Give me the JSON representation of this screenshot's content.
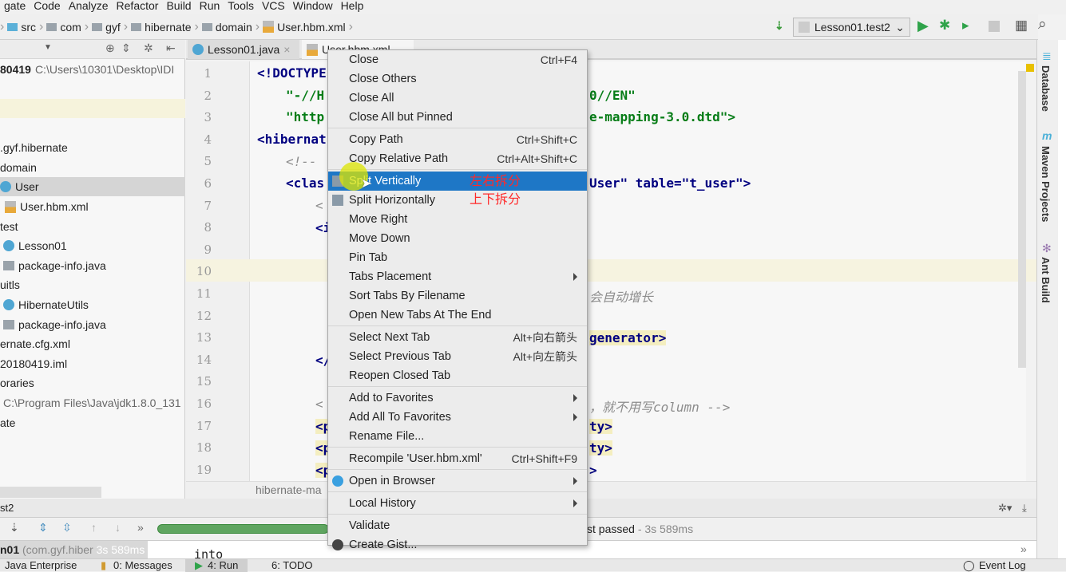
{
  "menubar": [
    "gate",
    "Code",
    "Analyze",
    "Refactor",
    "Build",
    "Run",
    "Tools",
    "VCS",
    "Window",
    "Help"
  ],
  "breadcrumb": [
    "src",
    "com",
    "gyf",
    "hibernate",
    "domain",
    "User.hbm.xml"
  ],
  "run_config": "Lesson01.test2",
  "project": {
    "root": "80419",
    "root_path": "C:\\Users\\10301\\Desktop\\IDI",
    "items": [
      ".gyf.hibernate",
      "domain",
      "User",
      "User.hbm.xml",
      "test",
      "Lesson01",
      "package-info.java",
      "uitls",
      "HibernateUtils",
      "package-info.java",
      "ernate.cfg.xml",
      "20180419.iml",
      "oraries",
      "C:\\Program Files\\Java\\jdk1.8.0_131",
      "ate"
    ]
  },
  "tabs": [
    "Lesson01.java",
    "User.hbm.xml"
  ],
  "editor": {
    "line_numbers": [
      "1",
      "2",
      "3",
      "4",
      "5",
      "6",
      "7",
      "8",
      "9",
      "10",
      "11",
      "12",
      "13",
      "14",
      "15",
      "16",
      "17",
      "18",
      "19"
    ],
    "code": {
      "l1": "<!DOCTYPE",
      "l2a": "\"-//H",
      "l2b": "0//EN\"",
      "l3a": "\"http",
      "l3b": "e-mapping-3.0.dtd\">",
      "l4": "<hibernat",
      "l5": "<!--",
      "l6a": "<clas",
      "l6b": "User\" table=\"t_user\">",
      "l7": "<",
      "l8": "<i",
      "l11": "会自动增长",
      "l13": "generator>",
      "l14": "</",
      "l16a": "<",
      "l16b": "，就不用写column -->",
      "l17a": "<p",
      "l17b": "ty>",
      "l18a": "<p",
      "l18b": "ty>",
      "l19a": "<p",
      "l19b": ">"
    },
    "breadcrumb": "hibernate-ma"
  },
  "context_menu": {
    "items": [
      {
        "label": "Close",
        "shortcut": "Ctrl+F4"
      },
      {
        "label": "Close Others"
      },
      {
        "label": "Close All"
      },
      {
        "label": "Close All but Pinned"
      },
      {
        "label": "Copy Path",
        "shortcut": "Ctrl+Shift+C"
      },
      {
        "label": "Copy Relative Path",
        "shortcut": "Ctrl+Alt+Shift+C"
      },
      {
        "label": "Split Vertically",
        "selected": true
      },
      {
        "label": "Split Horizontally"
      },
      {
        "label": "Move Right"
      },
      {
        "label": "Move Down"
      },
      {
        "label": "Pin Tab"
      },
      {
        "label": "Tabs Placement",
        "submenu": true
      },
      {
        "label": "Sort Tabs By Filename"
      },
      {
        "label": "Open New Tabs At The End"
      },
      {
        "label": "Select Next Tab",
        "shortcut": "Alt+向右箭头"
      },
      {
        "label": "Select Previous Tab",
        "shortcut": "Alt+向左箭头"
      },
      {
        "label": "Reopen Closed Tab"
      },
      {
        "label": "Add to Favorites",
        "submenu": true
      },
      {
        "label": "Add All To Favorites",
        "submenu": true
      },
      {
        "label": "Rename File..."
      },
      {
        "label": "Recompile 'User.hbm.xml'",
        "shortcut": "Ctrl+Shift+F9"
      },
      {
        "label": "Open in Browser",
        "submenu": true
      },
      {
        "label": "Local History",
        "submenu": true
      },
      {
        "label": "Validate"
      },
      {
        "label": "Create Gist..."
      }
    ],
    "annotations": {
      "split_vertically": "左右拆分",
      "split_horizontally": "上下拆分"
    }
  },
  "right_tools": [
    "Database",
    "Maven Projects",
    "Ant Build"
  ],
  "run_panel": {
    "title": "st2",
    "status": "st passed",
    "time": " - 3s 589ms",
    "progress_percent": 100,
    "test_row": "n01",
    "test_pkg": " (com.gyf.hiber",
    "test_time": " 3s 589ms",
    "output": "into"
  },
  "statusbar": [
    "Java Enterprise",
    "0: Messages",
    "4: Run",
    "6: TODO",
    "Event Log"
  ],
  "colors": {
    "selection": "#1e77c6",
    "progress": "#5fa560",
    "annotation": "#ff2a2a"
  }
}
